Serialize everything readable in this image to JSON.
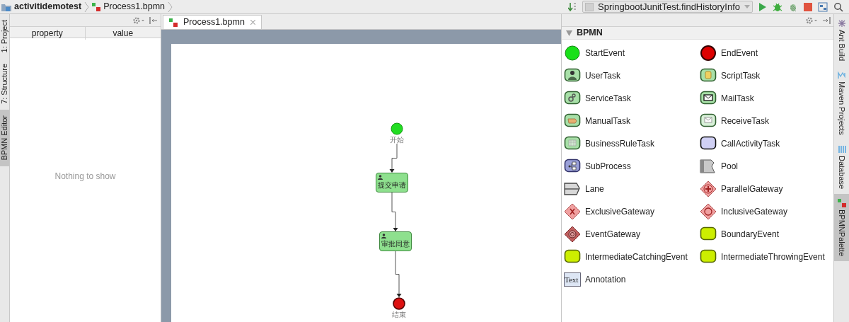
{
  "breadcrumb": [
    {
      "kind": "project",
      "label": "activitidemotest"
    },
    {
      "kind": "bpmn-file",
      "label": "Process1.bpmn"
    }
  ],
  "run_config": {
    "label": "SpringbootJunitTest.findHistoryInfo"
  },
  "left_tool_tabs": [
    {
      "label": "1: Project",
      "selected": false
    },
    {
      "label": "7: Structure",
      "selected": false
    },
    {
      "label": "BPMN Editor",
      "selected": true
    }
  ],
  "properties": {
    "columns": [
      "property",
      "value"
    ],
    "empty_text": "Nothing to show"
  },
  "editor_tabs": [
    {
      "label": "Process1.bpmn",
      "selected": true
    }
  ],
  "diagram": {
    "nodes": [
      {
        "kind": "start",
        "label": "开始"
      },
      {
        "kind": "user-task",
        "label": "提交申请"
      },
      {
        "kind": "user-task",
        "label": "审批同意"
      },
      {
        "kind": "end",
        "label": "结束"
      }
    ]
  },
  "palette": {
    "title": "BPMN",
    "expanded": true,
    "items": [
      {
        "kind": "start-event",
        "label": "StartEvent"
      },
      {
        "kind": "end-event",
        "label": "EndEvent"
      },
      {
        "kind": "user-task",
        "label": "UserTask"
      },
      {
        "kind": "script-task",
        "label": "ScriptTask"
      },
      {
        "kind": "service-task",
        "label": "ServiceTask"
      },
      {
        "kind": "mail-task",
        "label": "MailTask"
      },
      {
        "kind": "manual-task",
        "label": "ManualTask"
      },
      {
        "kind": "receive-task",
        "label": "ReceiveTask"
      },
      {
        "kind": "business-rule-task",
        "label": "BusinessRuleTask"
      },
      {
        "kind": "call-activity",
        "label": "CallActivityTask"
      },
      {
        "kind": "sub-process",
        "label": "SubProcess"
      },
      {
        "kind": "pool",
        "label": "Pool"
      },
      {
        "kind": "lane",
        "label": "Lane"
      },
      {
        "kind": "parallel-gateway",
        "label": "ParallelGateway"
      },
      {
        "kind": "exclusive-gateway",
        "label": "ExclusiveGateway"
      },
      {
        "kind": "inclusive-gateway",
        "label": "InclusiveGateway"
      },
      {
        "kind": "event-gateway",
        "label": "EventGateway"
      },
      {
        "kind": "boundary-event",
        "label": "BoundaryEvent"
      },
      {
        "kind": "catching-event",
        "label": "IntermediateCatchingEvent"
      },
      {
        "kind": "throwing-event",
        "label": "IntermediateThrowingEvent"
      },
      {
        "kind": "annotation",
        "label": "Annotation",
        "icon_text": "Text"
      }
    ]
  },
  "right_tool_tabs": [
    {
      "kind": "ant",
      "label": "Ant Build",
      "selected": false
    },
    {
      "kind": "maven",
      "label": "Maven Projects",
      "selected": false
    },
    {
      "kind": "database",
      "label": "Database",
      "selected": false
    },
    {
      "kind": "bpmn",
      "label": "BPMNPalette",
      "selected": true
    }
  ]
}
